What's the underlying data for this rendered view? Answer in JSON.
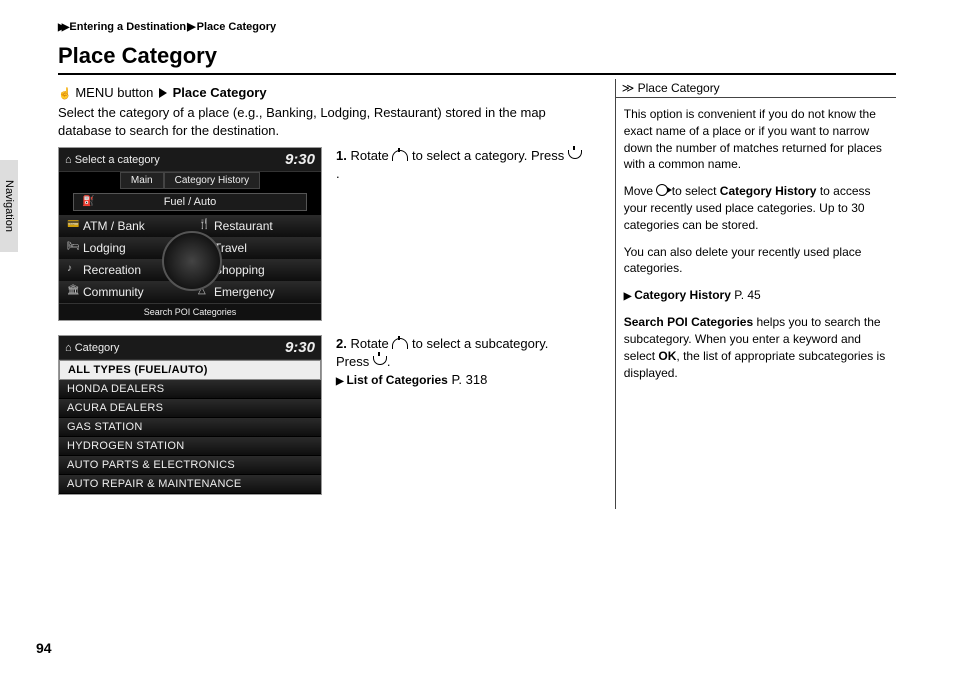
{
  "breadcrumb": {
    "s1": "Entering a Destination",
    "s2": "Place Category"
  },
  "title": "Place Category",
  "sideTab": "Navigation",
  "menuLine": {
    "a": "MENU button",
    "b": "Place Category"
  },
  "intro": "Select the category of a place (e.g., Banking, Lodging, Restaurant) stored in the map database to search for the destination.",
  "screen1": {
    "title": "Select a category",
    "time": "9:30",
    "tabs": {
      "a": "Main",
      "b": "Category History"
    },
    "center": "Fuel / Auto",
    "cells": [
      "ATM / Bank",
      "Restaurant",
      "Lodging",
      "Travel",
      "Recreation",
      "Shopping",
      "Community",
      "Emergency"
    ],
    "footer": "Search POI Categories"
  },
  "screen2": {
    "title": "Category",
    "time": "9:30",
    "rows": [
      "ALL TYPES (FUEL/AUTO)",
      "HONDA DEALERS",
      "ACURA DEALERS",
      "GAS STATION",
      "HYDROGEN STATION",
      "AUTO PARTS & ELECTRONICS",
      "AUTO REPAIR & MAINTENANCE"
    ]
  },
  "step1": {
    "n": "1.",
    "a": "Rotate ",
    "b": " to select a category. Press ",
    "c": "."
  },
  "step2": {
    "n": "2.",
    "a": "Rotate ",
    "b": " to select a subcategory. Press ",
    "c": ".",
    "ref": "List of Categories",
    "pg": " P. 318"
  },
  "side": {
    "hdr": "Place Category",
    "p1": "This option is convenient if you do not know the exact name of a place or if you want to narrow down the number of matches returned for places with a common name.",
    "p2a": "Move ",
    "p2b": " to select ",
    "p2c": "Category History",
    "p2d": " to access your recently used place categories. Up to 30 categories can be stored.",
    "p3": "You can also delete your recently used place categories.",
    "ref": "Category History",
    "refPg": " P. 45",
    "p4a": "Search POI Categories",
    "p4b": " helps you to search the subcategory. When you enter a keyword and select ",
    "p4c": "OK",
    "p4d": ", the list of appropriate subcategories is displayed."
  },
  "pageNum": "94"
}
